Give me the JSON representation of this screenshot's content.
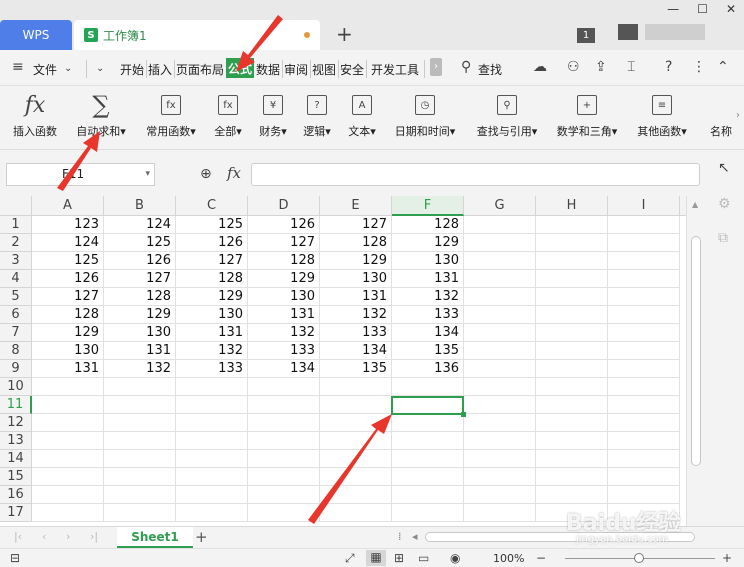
{
  "titlebar": {
    "app_tab": "WPS",
    "doc_tab": "工作簿1",
    "doc_logo": "S",
    "new_tab_icon": "plus-icon",
    "window_badge": "1"
  },
  "menubar": {
    "file": "文件",
    "items": [
      "开始",
      "插入",
      "页面布局",
      "公式",
      "数据",
      "审阅",
      "视图",
      "安全",
      "开发工具"
    ],
    "active": "公式",
    "search": "查找"
  },
  "ribbon": {
    "buttons": [
      {
        "label": "插入函数",
        "icon": "fx-icon"
      },
      {
        "label": "自动求和",
        "icon": "sigma-icon"
      },
      {
        "label": "常用函数",
        "icon": "common-functions-icon"
      },
      {
        "label": "全部",
        "icon": "all-functions-icon"
      },
      {
        "label": "财务",
        "icon": "finance-icon"
      },
      {
        "label": "逻辑",
        "icon": "logic-icon"
      },
      {
        "label": "文本",
        "icon": "text-icon"
      },
      {
        "label": "日期和时间",
        "icon": "clock-icon"
      },
      {
        "label": "查找与引用",
        "icon": "lookup-icon"
      },
      {
        "label": "数学和三角",
        "icon": "math-icon"
      },
      {
        "label": "其他函数",
        "icon": "other-functions-icon"
      },
      {
        "label": "名称",
        "icon": "name-manager-icon"
      }
    ]
  },
  "formula_bar": {
    "name_box": "F11",
    "fx": "fx",
    "content": ""
  },
  "sheet": {
    "columns": [
      "A",
      "B",
      "C",
      "D",
      "E",
      "F",
      "G",
      "H",
      "I"
    ],
    "rows": [
      "1",
      "2",
      "3",
      "4",
      "5",
      "6",
      "7",
      "8",
      "9",
      "10",
      "11",
      "12",
      "13",
      "14",
      "15",
      "16",
      "17"
    ],
    "data": [
      [
        "123",
        "124",
        "125",
        "126",
        "127",
        "128"
      ],
      [
        "124",
        "125",
        "126",
        "127",
        "128",
        "129"
      ],
      [
        "125",
        "126",
        "127",
        "128",
        "129",
        "130"
      ],
      [
        "126",
        "127",
        "128",
        "129",
        "130",
        "131"
      ],
      [
        "127",
        "128",
        "129",
        "130",
        "131",
        "132"
      ],
      [
        "128",
        "129",
        "130",
        "131",
        "132",
        "133"
      ],
      [
        "129",
        "130",
        "131",
        "132",
        "133",
        "134"
      ],
      [
        "130",
        "131",
        "132",
        "133",
        "134",
        "135"
      ],
      [
        "131",
        "132",
        "133",
        "134",
        "135",
        "136"
      ]
    ],
    "selected_cell": "F11"
  },
  "sheet_tabs": {
    "active": "Sheet1",
    "add_icon": "plus-icon"
  },
  "statusbar": {
    "zoom": "100%"
  },
  "watermark": {
    "text": "Baidu经验",
    "sub": "jingyan.baidu.com"
  },
  "colors": {
    "accent": "#2e9f4e",
    "wps_tab": "#4f7ee8",
    "arrow": "#e8362c"
  }
}
